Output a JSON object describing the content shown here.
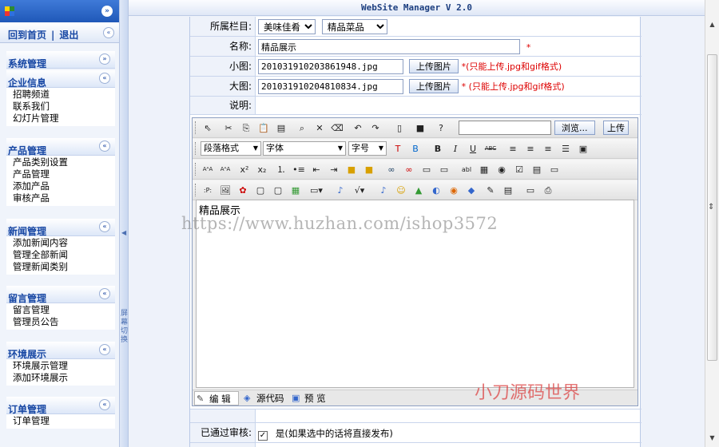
{
  "sidebar": {
    "links": {
      "home": "回到首页",
      "separator": "|",
      "logout": "退出"
    },
    "toggle_collapse": "«",
    "sections": [
      {
        "title": "系统管理",
        "toggle": "»",
        "items": []
      },
      {
        "title": "企业信息",
        "toggle": "«",
        "items": [
          "招聘频道",
          "联系我们",
          "幻灯片管理"
        ]
      },
      {
        "title": "产品管理",
        "toggle": "«",
        "items": [
          "产品类别设置",
          "产品管理",
          "添加产品",
          "审核产品"
        ]
      },
      {
        "title": "新闻管理",
        "toggle": "«",
        "items": [
          "添加新闻内容",
          "管理全部新闻",
          "管理新闻类别"
        ]
      },
      {
        "title": "留言管理",
        "toggle": "«",
        "items": [
          "留言管理",
          "管理员公告"
        ]
      },
      {
        "title": "环境展示",
        "toggle": "«",
        "items": [
          "环境展示管理",
          "添加环境展示"
        ]
      },
      {
        "title": "订单管理",
        "toggle": "«",
        "items": [
          "订单管理"
        ]
      }
    ],
    "splitter_text": "屏幕切换"
  },
  "header": {
    "title": "WebSite Manager V 2.0"
  },
  "form": {
    "category": {
      "label": "所属栏目:",
      "select1": "美味佳肴",
      "select2": "精品菜品"
    },
    "name": {
      "label": "名称:",
      "value": "精品展示",
      "required": "*"
    },
    "small_image": {
      "label": "小图:",
      "value": "201031910203861948.jpg",
      "button": "上传图片",
      "note": "*(只能上传.jpg和gif格式)"
    },
    "large_image": {
      "label": "大图:",
      "value": "201031910204810834.jpg",
      "button": "上传图片",
      "note": "* (只能上传.jpg和gif格式)"
    },
    "description": {
      "label": "说明:"
    },
    "approved": {
      "label": "已通过审核:",
      "checkbox_text": "是(如果选中的话将直接发布)"
    }
  },
  "editor": {
    "browse_button": "浏览...",
    "upload_button": "上传",
    "format_select": "段落格式",
    "font_select": "字体",
    "size_select": "字号",
    "content": "精品展示",
    "modes": {
      "edit": "编 辑",
      "source": "源代码",
      "preview": "预 览"
    }
  },
  "watermark": {
    "url": "https://www.huzhan.com/ishop3572",
    "brand": "小刀源码世界"
  },
  "colors": {
    "accent": "#1f58b8",
    "link": "#1646a3",
    "required": "#dd0000"
  }
}
